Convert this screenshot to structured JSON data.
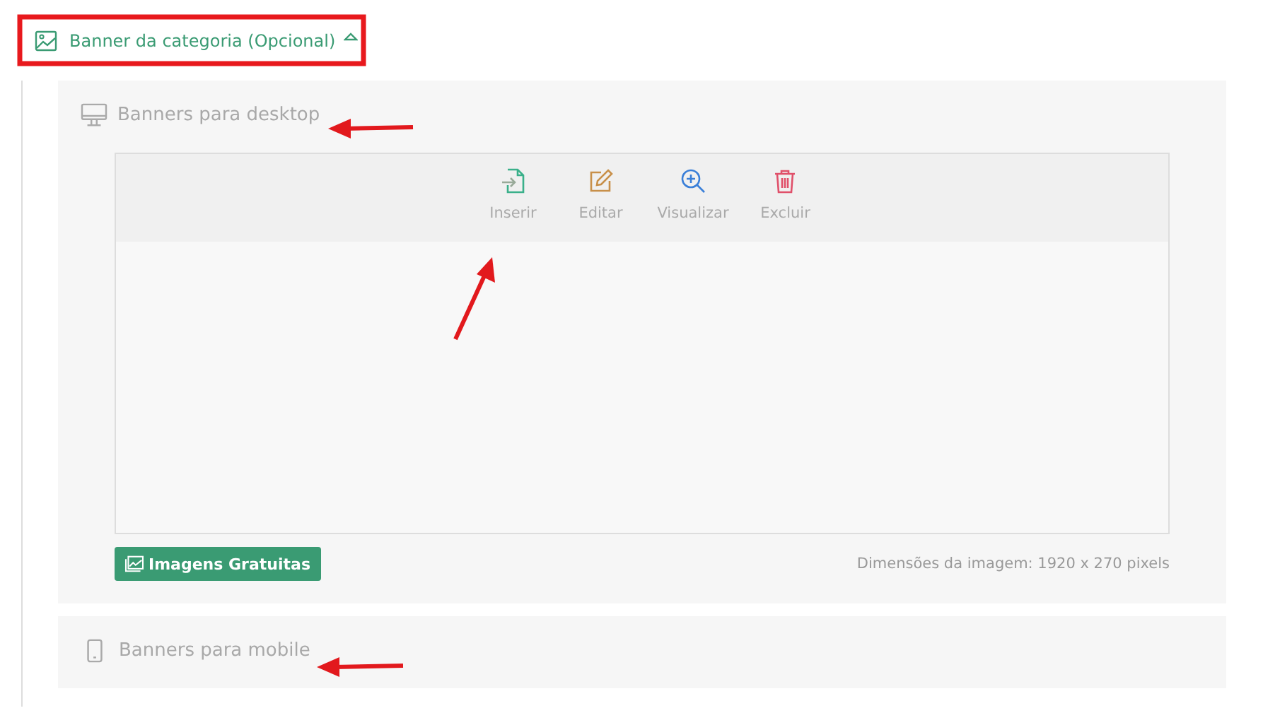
{
  "section": {
    "title": "Banner da categoria (Opcional)",
    "expanded": true
  },
  "desktop": {
    "title": "Banners para desktop",
    "actions": [
      {
        "kind": "insert",
        "label": "Inserir"
      },
      {
        "kind": "edit",
        "label": "Editar"
      },
      {
        "kind": "view",
        "label": "Visualizar"
      },
      {
        "kind": "delete",
        "label": "Excluir"
      }
    ],
    "button": "Imagens Gratuitas",
    "dimensions": "Dimensões da imagem: 1920 x 270 pixels"
  },
  "mobile": {
    "title": "Banners para mobile"
  }
}
